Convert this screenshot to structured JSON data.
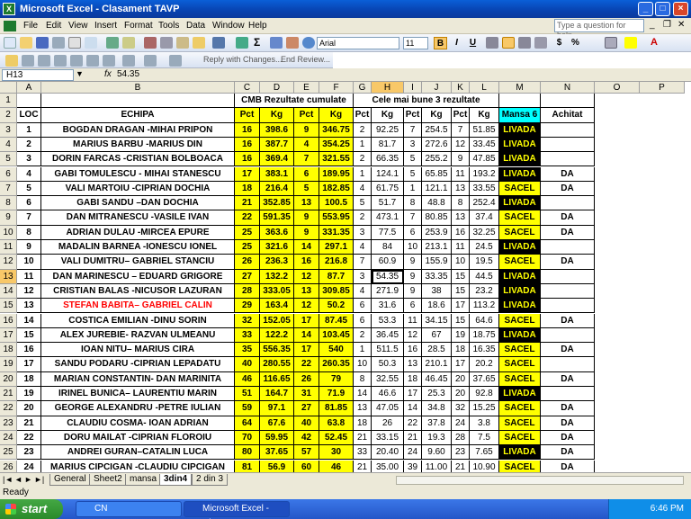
{
  "window": {
    "title": "Microsoft Excel - Clasament TAVP"
  },
  "menu": [
    "File",
    "Edit",
    "View",
    "Insert",
    "Format",
    "Tools",
    "Data",
    "Window",
    "Help"
  ],
  "ask_placeholder": "Type a question for help",
  "toolbar": {
    "font": "Arial",
    "size": "11",
    "bold": "B",
    "italic": "I",
    "underline": "U",
    "currency": "$",
    "percent": "%"
  },
  "toolbar2": {
    "reply": "Reply with Changes...",
    "end_review": "End Review..."
  },
  "formula": {
    "cell": "H13",
    "fx": "fx",
    "value": "54.35"
  },
  "columns": [
    "A",
    "B",
    "C",
    "D",
    "E",
    "F",
    "G",
    "H",
    "I",
    "J",
    "K",
    "L",
    "M",
    "N",
    "O",
    "P"
  ],
  "header1": {
    "cmb": "CMB Rezultate cumulate",
    "best3": "Cele mai bune 3 rezultate"
  },
  "header2": [
    "LOC",
    "ECHIPA",
    "Pct",
    "Kg",
    "Pct",
    "Kg",
    "Pct",
    "Kg",
    "Pct",
    "Kg",
    "Pct",
    "Kg",
    "Mansa 6",
    "Achitat"
  ],
  "rows": [
    [
      "1",
      "BOGDAN DRAGAN -MIHAI PRIPON",
      "16",
      "398.6",
      "9",
      "346.75",
      "2",
      "92.25",
      "7",
      "254.5",
      "7",
      "51.85",
      "LIVADA",
      ""
    ],
    [
      "2",
      "MARIUS BARBU -MARIUS DIN",
      "16",
      "387.7",
      "4",
      "354.25",
      "1",
      "81.7",
      "3",
      "272.6",
      "12",
      "33.45",
      "LIVADA",
      ""
    ],
    [
      "3",
      "DORIN FARCAS -CRISTIAN BOLBOACA",
      "16",
      "369.4",
      "7",
      "321.55",
      "2",
      "66.35",
      "5",
      "255.2",
      "9",
      "47.85",
      "LIVADA",
      ""
    ],
    [
      "4",
      "GABI TOMULESCU - MIHAI STANESCU",
      "17",
      "383.1",
      "6",
      "189.95",
      "1",
      "124.1",
      "5",
      "65.85",
      "11",
      "193.2",
      "LIVADA",
      "DA"
    ],
    [
      "5",
      "VALI MARTOIU -CIPRIAN DOCHIA",
      "18",
      "216.4",
      "5",
      "182.85",
      "4",
      "61.75",
      "1",
      "121.1",
      "13",
      "33.55",
      "SACEL",
      "DA"
    ],
    [
      "6",
      "GABI SANDU –DAN DOCHIA",
      "21",
      "352.85",
      "13",
      "100.5",
      "5",
      "51.7",
      "8",
      "48.8",
      "8",
      "252.4",
      "LIVADA",
      ""
    ],
    [
      "7",
      "DAN MITRANESCU -VASILE IVAN",
      "22",
      "591.35",
      "9",
      "553.95",
      "2",
      "473.1",
      "7",
      "80.85",
      "13",
      "37.4",
      "SACEL",
      "DA"
    ],
    [
      "8",
      "ADRIAN DULAU -MIRCEA EPURE",
      "25",
      "363.6",
      "9",
      "331.35",
      "3",
      "77.5",
      "6",
      "253.9",
      "16",
      "32.25",
      "SACEL",
      "DA"
    ],
    [
      "9",
      "MADALIN BARNEA -IONESCU IONEL",
      "25",
      "321.6",
      "14",
      "297.1",
      "4",
      "84",
      "10",
      "213.1",
      "11",
      "24.5",
      "LIVADA",
      ""
    ],
    [
      "10",
      "VALI DUMITRU– GABRIEL STANCIU",
      "26",
      "236.3",
      "16",
      "216.8",
      "7",
      "60.9",
      "9",
      "155.9",
      "10",
      "19.5",
      "SACEL",
      "DA"
    ],
    [
      "11",
      "DAN MARINESCU – EDUARD GRIGORE",
      "27",
      "132.2",
      "12",
      "87.7",
      "3",
      "54.35",
      "9",
      "33.35",
      "15",
      "44.5",
      "LIVADA",
      ""
    ],
    [
      "12",
      "CRISTIAN BALAS -NICUSOR LAZURAN",
      "28",
      "333.05",
      "13",
      "309.85",
      "4",
      "271.9",
      "9",
      "38",
      "15",
      "23.2",
      "LIVADA",
      ""
    ],
    [
      "13",
      "STEFAN BABITA– GABRIEL CALIN",
      "29",
      "163.4",
      "12",
      "50.2",
      "6",
      "31.6",
      "6",
      "18.6",
      "17",
      "113.2",
      "LIVADA",
      ""
    ],
    [
      "14",
      "COSTICA EMILIAN -DINU SORIN",
      "32",
      "152.05",
      "17",
      "87.45",
      "6",
      "53.3",
      "11",
      "34.15",
      "15",
      "64.6",
      "SACEL",
      "DA"
    ],
    [
      "15",
      "ALEX JUREBIE- RAZVAN ULMEANU",
      "33",
      "122.2",
      "14",
      "103.45",
      "2",
      "36.45",
      "12",
      "67",
      "19",
      "18.75",
      "LIVADA",
      ""
    ],
    [
      "16",
      "IOAN NITU– MARIUS CIRA",
      "35",
      "556.35",
      "17",
      "540",
      "1",
      "511.5",
      "16",
      "28.5",
      "18",
      "16.35",
      "SACEL",
      "DA"
    ],
    [
      "17",
      "SANDU PODARU -CIPRIAN LEPADATU",
      "40",
      "280.55",
      "22",
      "260.35",
      "10",
      "50.3",
      "13",
      "210.1",
      "17",
      "20.2",
      "SACEL",
      ""
    ],
    [
      "18",
      "MARIAN CONSTANTIN- DAN MARINITA",
      "46",
      "116.65",
      "26",
      "79",
      "8",
      "32.55",
      "18",
      "46.45",
      "20",
      "37.65",
      "SACEL",
      "DA"
    ],
    [
      "19",
      "IRINEL BUNICA– LAURENTIU MARIN",
      "51",
      "164.7",
      "31",
      "71.9",
      "14",
      "46.6",
      "17",
      "25.3",
      "20",
      "92.8",
      "LIVADA",
      ""
    ],
    [
      "20",
      "GEORGE ALEXANDRU -PETRE IULIAN",
      "59",
      "97.1",
      "27",
      "81.85",
      "13",
      "47.05",
      "14",
      "34.8",
      "32",
      "15.25",
      "SACEL",
      "DA"
    ],
    [
      "21",
      "CLAUDIU COSMA- IOAN ADRIAN",
      "64",
      "67.6",
      "40",
      "63.8",
      "18",
      "26",
      "22",
      "37.8",
      "24",
      "3.8",
      "SACEL",
      "DA"
    ],
    [
      "22",
      "DORU MAILAT -CIPRIAN FLOROIU",
      "70",
      "59.95",
      "42",
      "52.45",
      "21",
      "33.15",
      "21",
      "19.3",
      "28",
      "7.5",
      "SACEL",
      "DA"
    ],
    [
      "23",
      "ANDREI GURAN–CATALIN LUCA",
      "80",
      "37.65",
      "57",
      "30",
      "33",
      "20.40",
      "24",
      "9.60",
      "23",
      "7.65",
      "LIVADA",
      "DA"
    ],
    [
      "24",
      "MARIUS CIPCIGAN -CLAUDIU CIPCIGAN",
      "81",
      "56.9",
      "60",
      "46",
      "21",
      "35.00",
      "39",
      "11.00",
      "21",
      "10.90",
      "SACEL",
      "DA"
    ]
  ],
  "sheet_tabs": [
    "General",
    "Sheet2",
    "mansa",
    "3din4",
    "2 din 3"
  ],
  "active_tab": "3din4",
  "status": "Ready",
  "taskbar": {
    "start": "start",
    "folder": "CN",
    "excel": "Microsoft Excel - Clas...",
    "clock": "6:46 PM"
  },
  "colors": {
    "yellow": "#ffff00",
    "black": "#000000",
    "cyan": "#00ffff",
    "red": "#ff0000",
    "title_blue": "#0842b0"
  }
}
